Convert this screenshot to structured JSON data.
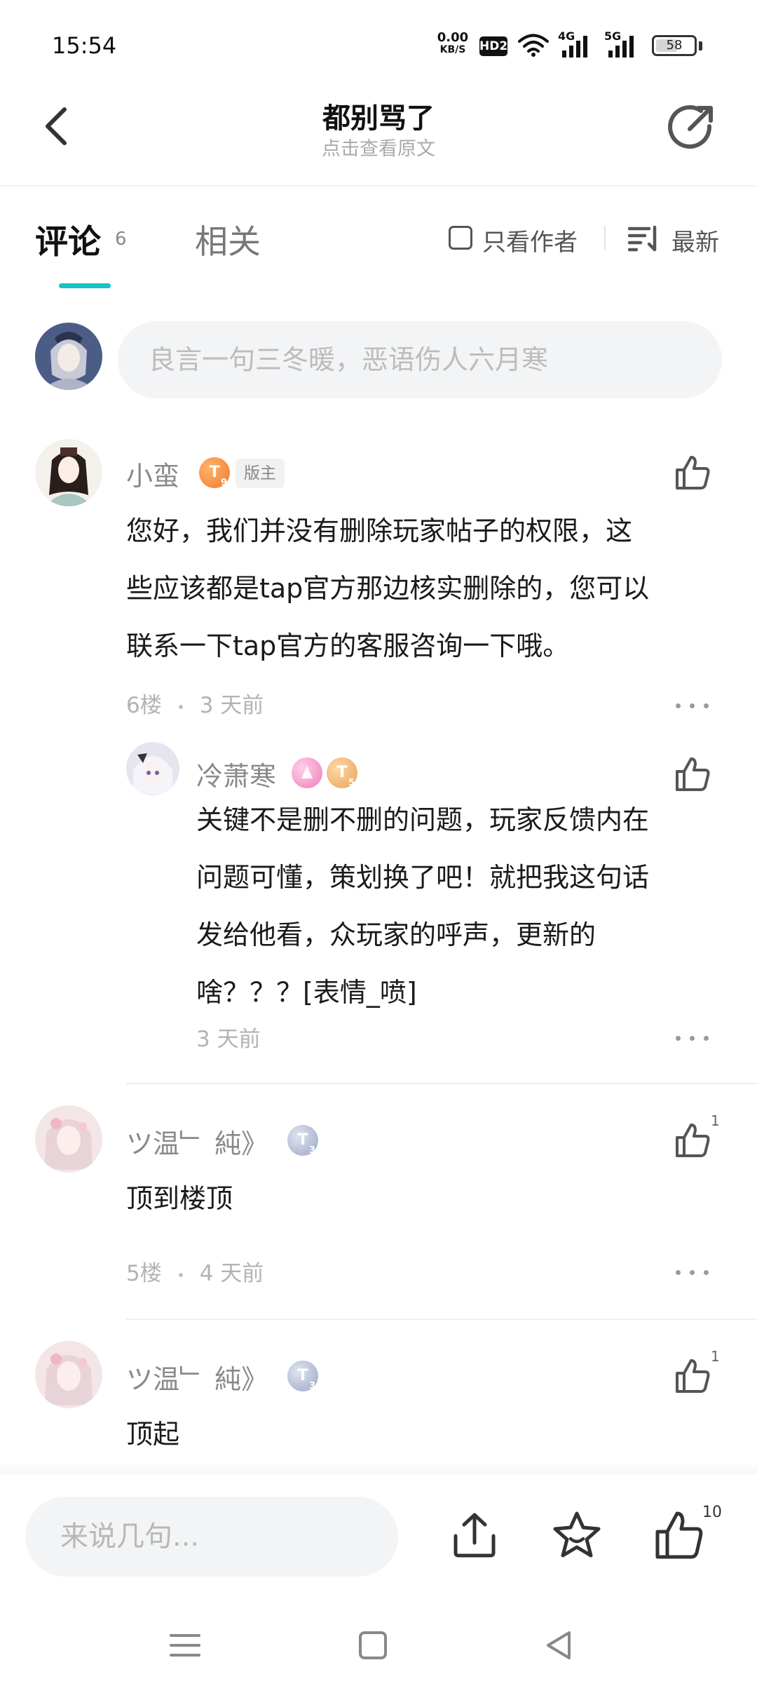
{
  "status_bar": {
    "time": "15:54",
    "net_speed_value": "0.00",
    "net_speed_unit": "KB/S",
    "hd_badge": "HD2",
    "signal_1_label": "4G",
    "signal_2_label": "5G",
    "battery_level": "58"
  },
  "header": {
    "title": "都别骂了",
    "subtitle": "点击查看原文"
  },
  "tabs": {
    "comments_label": "评论",
    "comments_count": "6",
    "related_label": "相关",
    "author_only_label": "只看作者",
    "sort_label": "最新"
  },
  "composer": {
    "placeholder": "良言一句三冬暖，恶语伤人六月寒"
  },
  "comments": [
    {
      "username": "小蛮",
      "badge_letter": "T",
      "badge_level": "9",
      "role_tag": "版主",
      "text_lines": [
        "您好，我们并没有删除玩家帖子的权限，这",
        "些应该都是tap官方那边核实删除的，您可以",
        "联系一下tap官方的客服咨询一下哦。"
      ],
      "floor": "6楼",
      "time": "3 天前",
      "reply": {
        "username": "冷萧寒",
        "badge_letter": "T",
        "badge_level": "5",
        "text_lines": [
          "关键不是删不删的问题，玩家反馈内在",
          "问题可懂，策划换了吧！就把我这句话",
          "发给他看，众玩家的呼声，更新的",
          "啥？？？[表情_喷]"
        ],
        "time": "3 天前"
      }
    },
    {
      "username": "ツ温﹂ 純》",
      "badge_letter": "T",
      "badge_level": "3",
      "text": "顶到楼顶",
      "like_count": "1",
      "floor": "5楼",
      "time": "4 天前"
    },
    {
      "username": "ツ温﹂ 純》",
      "badge_letter": "T",
      "badge_level": "3",
      "text": "顶起",
      "like_count": "1"
    }
  ],
  "bottom_bar": {
    "reply_placeholder": "来说几句...",
    "like_count": "10"
  },
  "icons": {
    "back": "back-arrow-icon",
    "share": "share-icon",
    "sort": "sort-list-icon",
    "like": "thumbs-up-icon",
    "more": "more-dots-icon",
    "upload": "upload-share-icon",
    "favorite": "star-icon",
    "menu": "menu-icon",
    "home": "home-square-icon",
    "system_back": "triangle-back-icon"
  },
  "colors": {
    "accent": "#14c4c4",
    "badge_orange": "#f07a2a",
    "badge_silver": "#9aa6c4"
  }
}
